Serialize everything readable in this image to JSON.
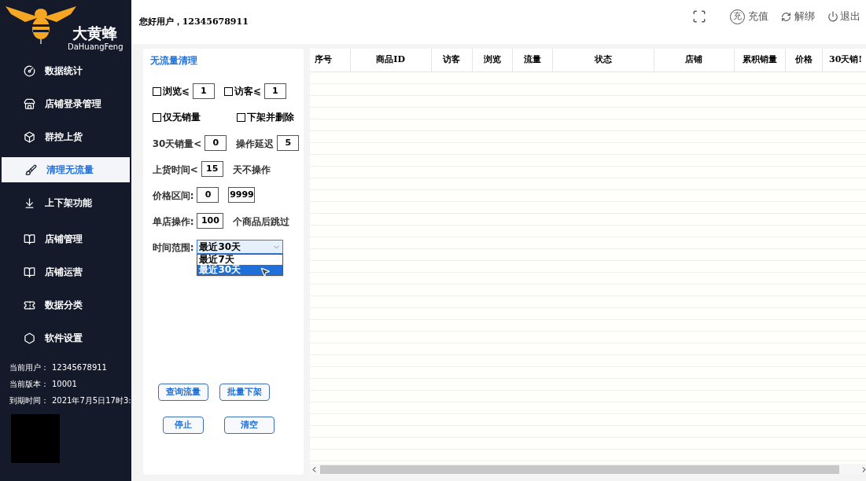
{
  "brand": {
    "name": "大黄蜂",
    "subtitle": "DaHuangFeng"
  },
  "sidebar": {
    "items": [
      {
        "label": "数据统计",
        "selected": false
      },
      {
        "label": "店铺登录管理",
        "selected": false
      },
      {
        "label": "群控上货",
        "selected": false
      },
      {
        "label": "清理无流量",
        "selected": true
      },
      {
        "label": "上下架功能",
        "selected": false
      },
      {
        "label": "店铺管理",
        "selected": false
      },
      {
        "label": "店铺运营",
        "selected": false
      },
      {
        "label": "数据分类",
        "selected": false
      },
      {
        "label": "软件设置",
        "selected": false
      }
    ],
    "info": [
      {
        "label": "当前用户：",
        "value": "12345678911"
      },
      {
        "label": "当前版本：",
        "value": "10001"
      },
      {
        "label": "到期时间：",
        "value": "2021年7月5日17时3:"
      }
    ]
  },
  "header": {
    "greeting": "您好用户，12345678911",
    "actions": [
      {
        "kind": "fullscreen"
      },
      {
        "kind": "recharge",
        "badge": "充",
        "label": "充值"
      },
      {
        "kind": "unbind",
        "label": "解绑"
      },
      {
        "kind": "logout",
        "label": "退出"
      }
    ]
  },
  "panel": {
    "title": "无流量清理",
    "lines": [
      {
        "parts": [
          {
            "kind": "checkbox",
            "label": "浏览⩽",
            "checked": false
          },
          {
            "kind": "input",
            "value": "1"
          },
          {
            "kind": "checkbox",
            "label": "访客⩽",
            "checked": false
          },
          {
            "kind": "input",
            "value": "1"
          }
        ]
      },
      {
        "parts": [
          {
            "kind": "checkbox",
            "label": "仅无销量",
            "checked": false
          },
          {
            "kind": "checkbox",
            "label": "下架并删除",
            "checked": false
          }
        ]
      },
      {
        "parts": [
          {
            "kind": "label",
            "label": "30天销量<"
          },
          {
            "kind": "input",
            "value": "0"
          },
          {
            "kind": "label",
            "label": "操作延迟"
          },
          {
            "kind": "input",
            "value": "5"
          }
        ]
      },
      {
        "parts": [
          {
            "kind": "label",
            "label": "上货时间<"
          },
          {
            "kind": "input",
            "value": "15"
          },
          {
            "kind": "label",
            "label": "天不操作"
          }
        ]
      },
      {
        "parts": [
          {
            "kind": "label",
            "label": "价格区间:"
          },
          {
            "kind": "input",
            "value": "0"
          },
          {
            "kind": "input",
            "value": "9999"
          }
        ]
      },
      {
        "parts": [
          {
            "kind": "label",
            "label": "单店操作:"
          },
          {
            "kind": "input",
            "value": "100"
          },
          {
            "kind": "label",
            "label": "个商品后跳过"
          }
        ]
      },
      {
        "parts": [
          {
            "kind": "label",
            "label": "时间范围:"
          },
          {
            "kind": "select",
            "value": "最近30天",
            "expanded": true,
            "options": [
              {
                "label": "最近7天",
                "selected": false
              },
              {
                "label": "最近30天",
                "selected": true
              }
            ]
          }
        ]
      }
    ],
    "buttons": [
      [
        "查询流量",
        "批量下架"
      ],
      [
        "停止",
        "清空"
      ]
    ]
  },
  "table": {
    "columns": [
      "序号",
      "商品ID",
      "访客",
      "浏览",
      "流量",
      "状态",
      "店铺",
      "累积销量",
      "价格",
      "30天销!"
    ]
  }
}
